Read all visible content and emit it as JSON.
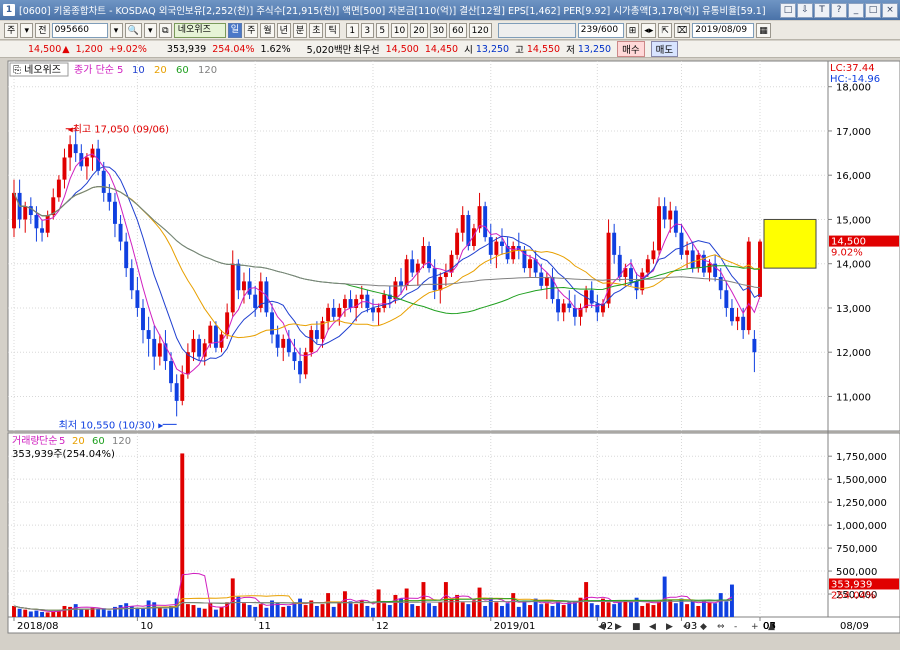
{
  "window": {
    "badge": "1",
    "title": "[0600] 키움종합차트 - KOSDAQ 외국인보유[2,252(천)] 주식수[21,915(천)] 액면[500] 자본금[110(억)] 결산[12월] EPS[1,462] PER[9.92] 시가총액[3,178(억)] 유통비율[59.1]",
    "buttons": [
      "□",
      "⇩",
      "T",
      "?",
      "_",
      "□",
      "×"
    ]
  },
  "toolbar": {
    "market_buttons": [
      "주",
      "▾",
      "전"
    ],
    "code": "095660",
    "icons": [
      "▾",
      "🔍",
      "▾",
      "⧉"
    ],
    "stock_name": "네오위즈",
    "mode_active": "일",
    "period_buttons": [
      "주",
      "월",
      "년",
      "분",
      "초",
      "틱"
    ],
    "interval_buttons": [
      "1",
      "3",
      "5",
      "10",
      "20",
      "30",
      "60",
      "120"
    ],
    "count": "239/600",
    "nav_icons": [
      "⊞",
      "◂▸",
      "⇱",
      "⌧"
    ],
    "date": "2019/08/09"
  },
  "quote": {
    "price": "14,500",
    "arrow": "▲",
    "change": "1,200",
    "change_pct": "+9.02%",
    "volume": "353,939",
    "volume_ratio": "254.04%",
    "turnover": "1.62%",
    "amount": "5,020백만",
    "best_label": "최우선",
    "best_ask": "14,500",
    "best_bid": "14,450",
    "open_label": "시",
    "open": "13,250",
    "high_label": "고",
    "high": "14,550",
    "low_label": "저",
    "low": "13,250",
    "buy_label": "매수",
    "sell_label": "매도"
  },
  "price_panel": {
    "stock_box": "네오위즈",
    "legend": [
      {
        "text": "종가 단순",
        "color": "#d020c0"
      },
      {
        "text": "5",
        "color": "#d020c0"
      },
      {
        "text": "10",
        "color": "#2040d0"
      },
      {
        "text": "20",
        "color": "#e8a000"
      },
      {
        "text": "60",
        "color": "#20a020"
      },
      {
        "text": "120",
        "color": "#808080"
      }
    ],
    "lc_label": "LC:37.44",
    "hc_label": "HC:-14.96",
    "high_annotation": "최고 17,050 (09/06)",
    "low_annotation": "최저 10,550 (10/30)",
    "last_price_tag": "14,500",
    "last_pct_tag": "9.02%"
  },
  "volume_panel": {
    "legend": [
      {
        "text": "거래량",
        "color": "#d020c0"
      },
      {
        "text": "단순",
        "color": "#d020c0"
      },
      {
        "text": "5",
        "color": "#d020c0"
      },
      {
        "text": "20",
        "color": "#e8a000"
      },
      {
        "text": "60",
        "color": "#20a020"
      },
      {
        "text": "120",
        "color": "#808080"
      }
    ],
    "readout": "353,939주(254.04%)",
    "last_volume_tag": "353,939",
    "last_pct_tag": "254.04%"
  },
  "footer": {
    "date_tag": "08/09",
    "nav_icons": [
      "◀",
      "▶",
      "■",
      "◀",
      "▶",
      "↔",
      "◆",
      "⇔",
      "-",
      "+",
      "▲"
    ]
  },
  "colors": {
    "up": "#e00000",
    "down": "#1040e0",
    "ma5": "#d020c0",
    "ma10": "#2040d0",
    "ma20": "#e8a000",
    "ma60": "#20a020",
    "ma120": "#808080",
    "highlight": "#ffff00"
  },
  "chart_data": {
    "type": "candlestick",
    "x_tick_labels": [
      "2018/08",
      "10",
      "11",
      "12",
      "2019/01",
      "02",
      "03",
      "04",
      "05",
      "06",
      "07",
      "08"
    ],
    "price_axis": {
      "ticks": [
        11000,
        12000,
        13000,
        14000,
        15000,
        16000,
        17000,
        18000
      ],
      "range": [
        10400,
        18400
      ]
    },
    "volume_axis": {
      "ticks": [
        "250,000",
        "500,000",
        "750,000",
        "1,000,000",
        "1,250,000",
        "1,500,000",
        "1,750,000"
      ],
      "range": [
        0,
        1850000
      ]
    },
    "candles_approx": [
      [
        14800,
        15900,
        14600,
        15600
      ],
      [
        15600,
        15900,
        14800,
        15000
      ],
      [
        15000,
        15400,
        14700,
        15300
      ],
      [
        15300,
        15500,
        14900,
        15100
      ],
      [
        15100,
        15300,
        14500,
        14800
      ],
      [
        14800,
        15000,
        14500,
        14700
      ],
      [
        14700,
        15200,
        14600,
        15100
      ],
      [
        15100,
        15700,
        15000,
        15500
      ],
      [
        15500,
        16000,
        15400,
        15900
      ],
      [
        15900,
        16600,
        15700,
        16400
      ],
      [
        16400,
        16900,
        16100,
        16700
      ],
      [
        16700,
        17050,
        16300,
        16500
      ],
      [
        16500,
        16700,
        16100,
        16200
      ],
      [
        16200,
        16500,
        15900,
        16400
      ],
      [
        16400,
        16700,
        16100,
        16600
      ],
      [
        16600,
        16800,
        16000,
        16100
      ],
      [
        16100,
        16300,
        15400,
        15600
      ],
      [
        15600,
        15800,
        15200,
        15400
      ],
      [
        15400,
        15600,
        14600,
        14900
      ],
      [
        14900,
        15100,
        14300,
        14500
      ],
      [
        14500,
        14700,
        13700,
        13900
      ],
      [
        13900,
        14100,
        13200,
        13400
      ],
      [
        13400,
        13700,
        12800,
        13000
      ],
      [
        13000,
        13200,
        12200,
        12500
      ],
      [
        12500,
        12800,
        11900,
        12300
      ],
      [
        12300,
        12600,
        11600,
        11900
      ],
      [
        11900,
        12400,
        11700,
        12200
      ],
      [
        12200,
        12500,
        11600,
        11800
      ],
      [
        11800,
        12000,
        11100,
        11300
      ],
      [
        11300,
        11500,
        10550,
        10900
      ],
      [
        10900,
        11700,
        10800,
        11500
      ],
      [
        11500,
        12200,
        11400,
        12000
      ],
      [
        12000,
        12500,
        11800,
        12300
      ],
      [
        12300,
        12400,
        11800,
        11900
      ],
      [
        11900,
        12300,
        11700,
        12200
      ],
      [
        12200,
        12700,
        12100,
        12600
      ],
      [
        12600,
        12700,
        12000,
        12100
      ],
      [
        12100,
        12500,
        12000,
        12400
      ],
      [
        12400,
        13100,
        12300,
        12900
      ],
      [
        12900,
        14300,
        12800,
        14000
      ],
      [
        14000,
        14100,
        13200,
        13400
      ],
      [
        13400,
        13800,
        13100,
        13600
      ],
      [
        13600,
        13900,
        13200,
        13300
      ],
      [
        13300,
        13500,
        12800,
        13000
      ],
      [
        13000,
        13800,
        12900,
        13600
      ],
      [
        13600,
        13700,
        12800,
        12900
      ],
      [
        12900,
        13100,
        12200,
        12400
      ],
      [
        12400,
        12600,
        11900,
        12100
      ],
      [
        12100,
        12400,
        11800,
        12300
      ],
      [
        12300,
        12500,
        11900,
        12000
      ],
      [
        12000,
        12300,
        11600,
        11800
      ],
      [
        11800,
        12100,
        11300,
        11500
      ],
      [
        11500,
        12100,
        11400,
        12000
      ],
      [
        12000,
        12600,
        11900,
        12500
      ],
      [
        12500,
        12700,
        12200,
        12300
      ],
      [
        12300,
        12800,
        12100,
        12700
      ],
      [
        12700,
        13100,
        12500,
        13000
      ],
      [
        13000,
        13200,
        12700,
        12800
      ],
      [
        12800,
        13100,
        12600,
        13000
      ],
      [
        13000,
        13300,
        12800,
        13200
      ],
      [
        13200,
        13400,
        12900,
        13000
      ],
      [
        13000,
        13300,
        12700,
        13200
      ],
      [
        13200,
        13500,
        13000,
        13300
      ],
      [
        13300,
        13400,
        12900,
        13000
      ],
      [
        13000,
        13200,
        12700,
        12900
      ],
      [
        12900,
        13100,
        12600,
        13000
      ],
      [
        13000,
        13400,
        12900,
        13300
      ],
      [
        13300,
        13500,
        13000,
        13200
      ],
      [
        13200,
        13700,
        13100,
        13600
      ],
      [
        13600,
        13900,
        13300,
        13500
      ],
      [
        13500,
        14200,
        13400,
        14100
      ],
      [
        14100,
        14300,
        13700,
        13800
      ],
      [
        13800,
        14100,
        13500,
        14000
      ],
      [
        14000,
        14600,
        13900,
        14400
      ],
      [
        14400,
        14500,
        13800,
        13900
      ],
      [
        13900,
        14100,
        13200,
        13400
      ],
      [
        13400,
        13800,
        13100,
        13700
      ],
      [
        13700,
        14000,
        13500,
        13800
      ],
      [
        13800,
        14300,
        13700,
        14200
      ],
      [
        14200,
        14800,
        14100,
        14700
      ],
      [
        14700,
        15300,
        14500,
        15100
      ],
      [
        15100,
        15200,
        14300,
        14400
      ],
      [
        14400,
        14900,
        14300,
        14800
      ],
      [
        14800,
        15600,
        14700,
        15300
      ],
      [
        15300,
        15400,
        14500,
        14600
      ],
      [
        14600,
        14900,
        14000,
        14200
      ],
      [
        14200,
        14600,
        13900,
        14500
      ],
      [
        14500,
        14800,
        14200,
        14400
      ],
      [
        14400,
        14600,
        14000,
        14100
      ],
      [
        14100,
        14500,
        14000,
        14400
      ],
      [
        14400,
        14700,
        14100,
        14300
      ],
      [
        14300,
        14400,
        13800,
        13900
      ],
      [
        13900,
        14200,
        13700,
        14100
      ],
      [
        14100,
        14300,
        13700,
        13800
      ],
      [
        13800,
        14000,
        13400,
        13500
      ],
      [
        13500,
        13800,
        13200,
        13700
      ],
      [
        13700,
        13900,
        13100,
        13200
      ],
      [
        13200,
        13400,
        12700,
        12900
      ],
      [
        12900,
        13200,
        12700,
        13100
      ],
      [
        13100,
        13400,
        12900,
        13000
      ],
      [
        13000,
        13300,
        12600,
        12800
      ],
      [
        12800,
        13100,
        12600,
        13000
      ],
      [
        13000,
        13500,
        12900,
        13400
      ],
      [
        13400,
        13600,
        13000,
        13100
      ],
      [
        13100,
        13300,
        12700,
        12900
      ],
      [
        12900,
        13200,
        12800,
        13100
      ],
      [
        13100,
        15000,
        13000,
        14700
      ],
      [
        14700,
        14900,
        14000,
        14200
      ],
      [
        14200,
        14400,
        13600,
        13700
      ],
      [
        13700,
        14000,
        13500,
        13900
      ],
      [
        13900,
        14100,
        13500,
        13600
      ],
      [
        13600,
        13800,
        13200,
        13400
      ],
      [
        13400,
        13900,
        13300,
        13800
      ],
      [
        13800,
        14200,
        13700,
        14100
      ],
      [
        14100,
        14500,
        14000,
        14300
      ],
      [
        14300,
        15500,
        14200,
        15300
      ],
      [
        15300,
        15500,
        14800,
        15000
      ],
      [
        15000,
        15400,
        14700,
        15200
      ],
      [
        15200,
        15300,
        14600,
        14700
      ],
      [
        14700,
        14900,
        14100,
        14200
      ],
      [
        14200,
        14500,
        13900,
        14300
      ],
      [
        14300,
        14500,
        13800,
        13900
      ],
      [
        13900,
        14300,
        13800,
        14200
      ],
      [
        14200,
        14300,
        13700,
        13800
      ],
      [
        13800,
        14100,
        13600,
        14000
      ],
      [
        14000,
        14200,
        13600,
        13700
      ],
      [
        13700,
        13900,
        13200,
        13400
      ],
      [
        13400,
        13600,
        12800,
        13000
      ],
      [
        13000,
        13200,
        12600,
        12700
      ],
      [
        12700,
        13000,
        12500,
        12800
      ],
      [
        12800,
        13000,
        12300,
        12500
      ],
      [
        12500,
        14600,
        12400,
        14500
      ],
      [
        12300,
        12500,
        11550,
        12000
      ],
      [
        13250,
        14550,
        13250,
        14500
      ]
    ],
    "volume_approx_k": [
      120,
      90,
      80,
      60,
      70,
      55,
      50,
      60,
      75,
      120,
      110,
      140,
      90,
      80,
      100,
      85,
      95,
      70,
      110,
      130,
      150,
      120,
      100,
      90,
      180,
      160,
      110,
      90,
      120,
      200,
      1780,
      140,
      130,
      100,
      90,
      150,
      80,
      110,
      160,
      420,
      220,
      150,
      130,
      110,
      140,
      100,
      180,
      150,
      110,
      120,
      160,
      200,
      130,
      180,
      120,
      140,
      260,
      110,
      150,
      280,
      170,
      140,
      180,
      120,
      100,
      300,
      150,
      130,
      240,
      200,
      310,
      140,
      120,
      380,
      150,
      120,
      160,
      380,
      200,
      240,
      160,
      140,
      180,
      320,
      120,
      210,
      160,
      120,
      150,
      260,
      110,
      180,
      130,
      200,
      140,
      150,
      120,
      180,
      130,
      160,
      170,
      210,
      380,
      150,
      130,
      200,
      160,
      140,
      170,
      180,
      160,
      210,
      120,
      150,
      130,
      170,
      440,
      180,
      150,
      200,
      140,
      170,
      120,
      180,
      160,
      150,
      260,
      170,
      353
    ],
    "ma_series": [
      "ma5",
      "ma10",
      "ma20",
      "ma60",
      "ma120"
    ]
  }
}
